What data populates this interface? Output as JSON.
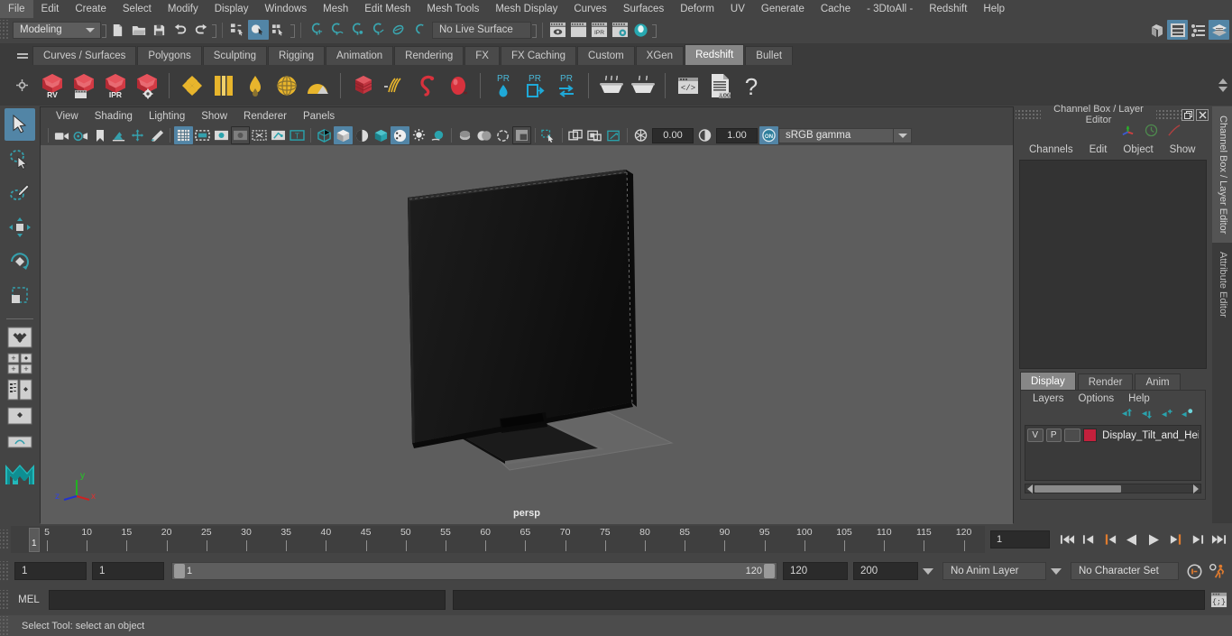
{
  "menubar": {
    "items": [
      "File",
      "Edit",
      "Create",
      "Select",
      "Modify",
      "Display",
      "Windows",
      "Mesh",
      "Edit Mesh",
      "Mesh Tools",
      "Mesh Display",
      "Curves",
      "Surfaces",
      "Deform",
      "UV",
      "Generate",
      "Cache",
      "- 3DtoAll -",
      "Redshift",
      "Help"
    ]
  },
  "statusline": {
    "menuset": "Modeling",
    "live_surface": "No Live Surface",
    "icons": {
      "new_scene": "new-scene-icon",
      "open_scene": "open-scene-icon",
      "save_scene": "save-scene-icon",
      "undo": "undo-icon",
      "redo": "redo-icon",
      "select_hierarchy": "select-by-hierarchy-icon",
      "select_object": "select-by-object-icon",
      "select_component": "select-by-component-icon",
      "snap_grid": "snap-to-grid-icon",
      "snap_curve": "snap-to-curve-icon",
      "snap_point": "snap-to-point-icon",
      "snap_projected": "snap-to-projected-center-icon",
      "snap_view_plane": "snap-to-view-plane-icon",
      "make_live": "make-live-icon",
      "render_view": "render-view-icon",
      "render_frame": "render-current-frame-icon",
      "ipr": "ipr-render-icon",
      "render_settings": "render-settings-icon",
      "hypershade": "hypershade-icon",
      "sidebar_toggle_1": "show-hide-modeling-toolkit-icon",
      "sidebar_toggle_2": "show-hide-attribute-editor-icon",
      "sidebar_toggle_3": "show-hide-tool-settings-icon",
      "sidebar_toggle_4": "show-hide-channel-box-icon"
    }
  },
  "shelf": {
    "tabs": [
      "Curves / Surfaces",
      "Polygons",
      "Sculpting",
      "Rigging",
      "Animation",
      "Rendering",
      "FX",
      "FX Caching",
      "Custom",
      "XGen",
      "Redshift",
      "Bullet"
    ],
    "active_tab": "Redshift",
    "buttons": [
      {
        "name": "redshift-render-view",
        "label": "RV"
      },
      {
        "name": "redshift-render-sequence",
        "label": ""
      },
      {
        "name": "redshift-ipr",
        "label": "IPR"
      },
      {
        "name": "redshift-render-settings",
        "label": ""
      },
      {
        "name": "redshift-material",
        "label": ""
      },
      {
        "name": "redshift-texture",
        "label": ""
      },
      {
        "name": "redshift-bump",
        "label": ""
      },
      {
        "name": "redshift-sprite",
        "label": ""
      },
      {
        "name": "redshift-environment",
        "label": ""
      },
      {
        "name": "redshift-proxy",
        "label": ""
      },
      {
        "name": "redshift-hair",
        "label": ""
      },
      {
        "name": "redshift-volume",
        "label": ""
      },
      {
        "name": "redshift-sphere",
        "label": ""
      },
      {
        "name": "redshift-pr-light",
        "label": "PR"
      },
      {
        "name": "redshift-pr-portal",
        "label": "PR"
      },
      {
        "name": "redshift-pr-exchange",
        "label": "PR"
      },
      {
        "name": "redshift-bake-1",
        "label": ""
      },
      {
        "name": "redshift-bake-2",
        "label": ""
      },
      {
        "name": "redshift-script",
        "label": ""
      },
      {
        "name": "redshift-log",
        "label": ".LOG"
      },
      {
        "name": "redshift-help",
        "label": "?"
      }
    ]
  },
  "toolbox": {
    "tools": [
      {
        "name": "select-tool",
        "active": true
      },
      {
        "name": "lasso-select-tool",
        "active": false
      },
      {
        "name": "paint-select-tool",
        "active": false
      },
      {
        "name": "move-tool",
        "active": false
      },
      {
        "name": "rotate-tool",
        "active": false
      },
      {
        "name": "scale-tool",
        "active": false
      }
    ],
    "layouts": [
      "single-perspective-layout",
      "four-view-layout",
      "outliner-persp-layout",
      "hypershade-persp-layout",
      "persp-graph-layout"
    ]
  },
  "viewport": {
    "menus": [
      "View",
      "Shading",
      "Lighting",
      "Show",
      "Renderer",
      "Panels"
    ],
    "exposure": "0.00",
    "gamma": "1.00",
    "color_management": "sRGB gamma",
    "camera_label": "persp",
    "axis": {
      "x": "x",
      "y": "y",
      "z": "z"
    },
    "icons": {
      "camera_attributes": "camera-attributes-icon",
      "bookmarks": "bookmark-icon",
      "image_plane": "image-plane-icon",
      "twod_pan_zoom": "2d-pan-zoom-icon",
      "grease_pencil": "grease-pencil-icon",
      "grid": "grid-toggle-icon",
      "film_gate": "film-gate-icon",
      "resolution_gate": "resolution-gate-icon",
      "gate_mask": "gate-mask-icon",
      "xray": "xray-icon",
      "xray_joints": "xray-joints-icon",
      "texture_mode": "texture-mode-icon",
      "wireframe": "wireframe-shading-icon",
      "smooth_shade": "smooth-shade-all-icon",
      "shade_wire": "shaded-wireframe-icon",
      "textured": "hardware-texturing-icon",
      "use_lights": "use-all-lights-icon",
      "shadows": "shadows-icon",
      "ao": "ambient-occlusion-icon",
      "aa": "anti-aliasing-icon",
      "motion_blur": "motion-blur-icon",
      "exposure_icon": "exposure-icon",
      "gamma_icon": "gamma-icon",
      "color_mgmt_toggle": "color-management-toggle-icon",
      "isolate_select": "isolate-select-icon"
    }
  },
  "right_panel": {
    "title": "Channel Box / Layer Editor",
    "window_buttons": {
      "restore": "restore-window-icon",
      "close": "close-window-icon"
    },
    "channelbox_menus": [
      "Channels",
      "Edit",
      "Object",
      "Show"
    ],
    "layer_tabs": [
      "Display",
      "Render",
      "Anim"
    ],
    "active_layer_tab": "Display",
    "layer_menus": [
      "Layers",
      "Options",
      "Help"
    ],
    "layer_buttons": [
      "move-layer-up-icon",
      "move-layer-down-icon",
      "create-new-layer-icon",
      "create-layer-from-selected-icon"
    ],
    "layers": [
      {
        "visibility": "V",
        "playback": "P",
        "shading": "",
        "color": "#c4203c",
        "name": "Display_Tilt_and_Heigl"
      }
    ],
    "side_tabs": [
      {
        "label": "Channel Box / Layer Editor",
        "active": true
      },
      {
        "label": "Attribute Editor",
        "active": false
      }
    ]
  },
  "timeline": {
    "labels": [
      5,
      10,
      15,
      20,
      25,
      30,
      35,
      40,
      45,
      50,
      55,
      60,
      65,
      70,
      75,
      80,
      85,
      90,
      95,
      100,
      105,
      110,
      115,
      120
    ],
    "start": 1,
    "end": 120,
    "current_frame": "1",
    "current_marker": "1",
    "frame_field": "1",
    "controls": [
      "go-to-start-icon",
      "step-back-keyframe-icon",
      "step-back-frame-icon",
      "play-backwards-icon",
      "play-forwards-icon",
      "step-forward-frame-icon",
      "step-forward-keyframe-icon",
      "go-to-end-icon"
    ]
  },
  "range": {
    "anim_start": "1",
    "range_start": "1",
    "slider_start": "1",
    "slider_end": "120",
    "range_end": "120",
    "anim_end": "200",
    "anim_layer": "No Anim Layer",
    "character_set": "No Character Set",
    "auto_key_icon": "auto-keyframe-icon",
    "anim_prefs_icon": "animation-preferences-icon"
  },
  "command_line": {
    "language": "MEL",
    "input_value": "",
    "output_value": "",
    "script_editor_icon": "script-editor-icon"
  },
  "helpline": {
    "text": "Select Tool: select an object"
  },
  "colors": {
    "accent_blue": "#5285a6",
    "shelf_red": "#d0353f",
    "layer_red": "#c4203c",
    "orange": "#d2752e",
    "teal": "#27a8b0"
  }
}
